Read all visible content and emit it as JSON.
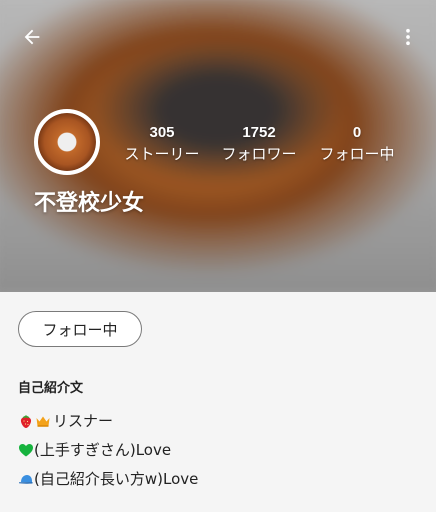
{
  "header": {
    "back_icon": "arrow-left-icon",
    "more_icon": "more-vertical-icon"
  },
  "profile": {
    "username": "不登校少女",
    "stats": {
      "stories": {
        "value": "305",
        "label": "ストーリー"
      },
      "following": {
        "value": "1752",
        "label": "フォロワー"
      },
      "followers": {
        "value": "0",
        "label": "フォロー中"
      }
    },
    "follow_button_label": "フォロー中"
  },
  "bio": {
    "heading": "自己紹介文",
    "lines": [
      {
        "emoji": [
          "strawberry-icon",
          "crown-icon"
        ],
        "text": "リスナー"
      },
      {
        "emoji": [
          "green-heart-icon"
        ],
        "text": "(上手すぎさん)Love"
      },
      {
        "emoji": [
          "blue-cap-icon"
        ],
        "text": "(自己紹介長い方w)Love"
      }
    ]
  },
  "colors": {
    "background": "#f5f5f5",
    "hero_text": "#ffffff",
    "button_border": "#7a7a7a"
  }
}
